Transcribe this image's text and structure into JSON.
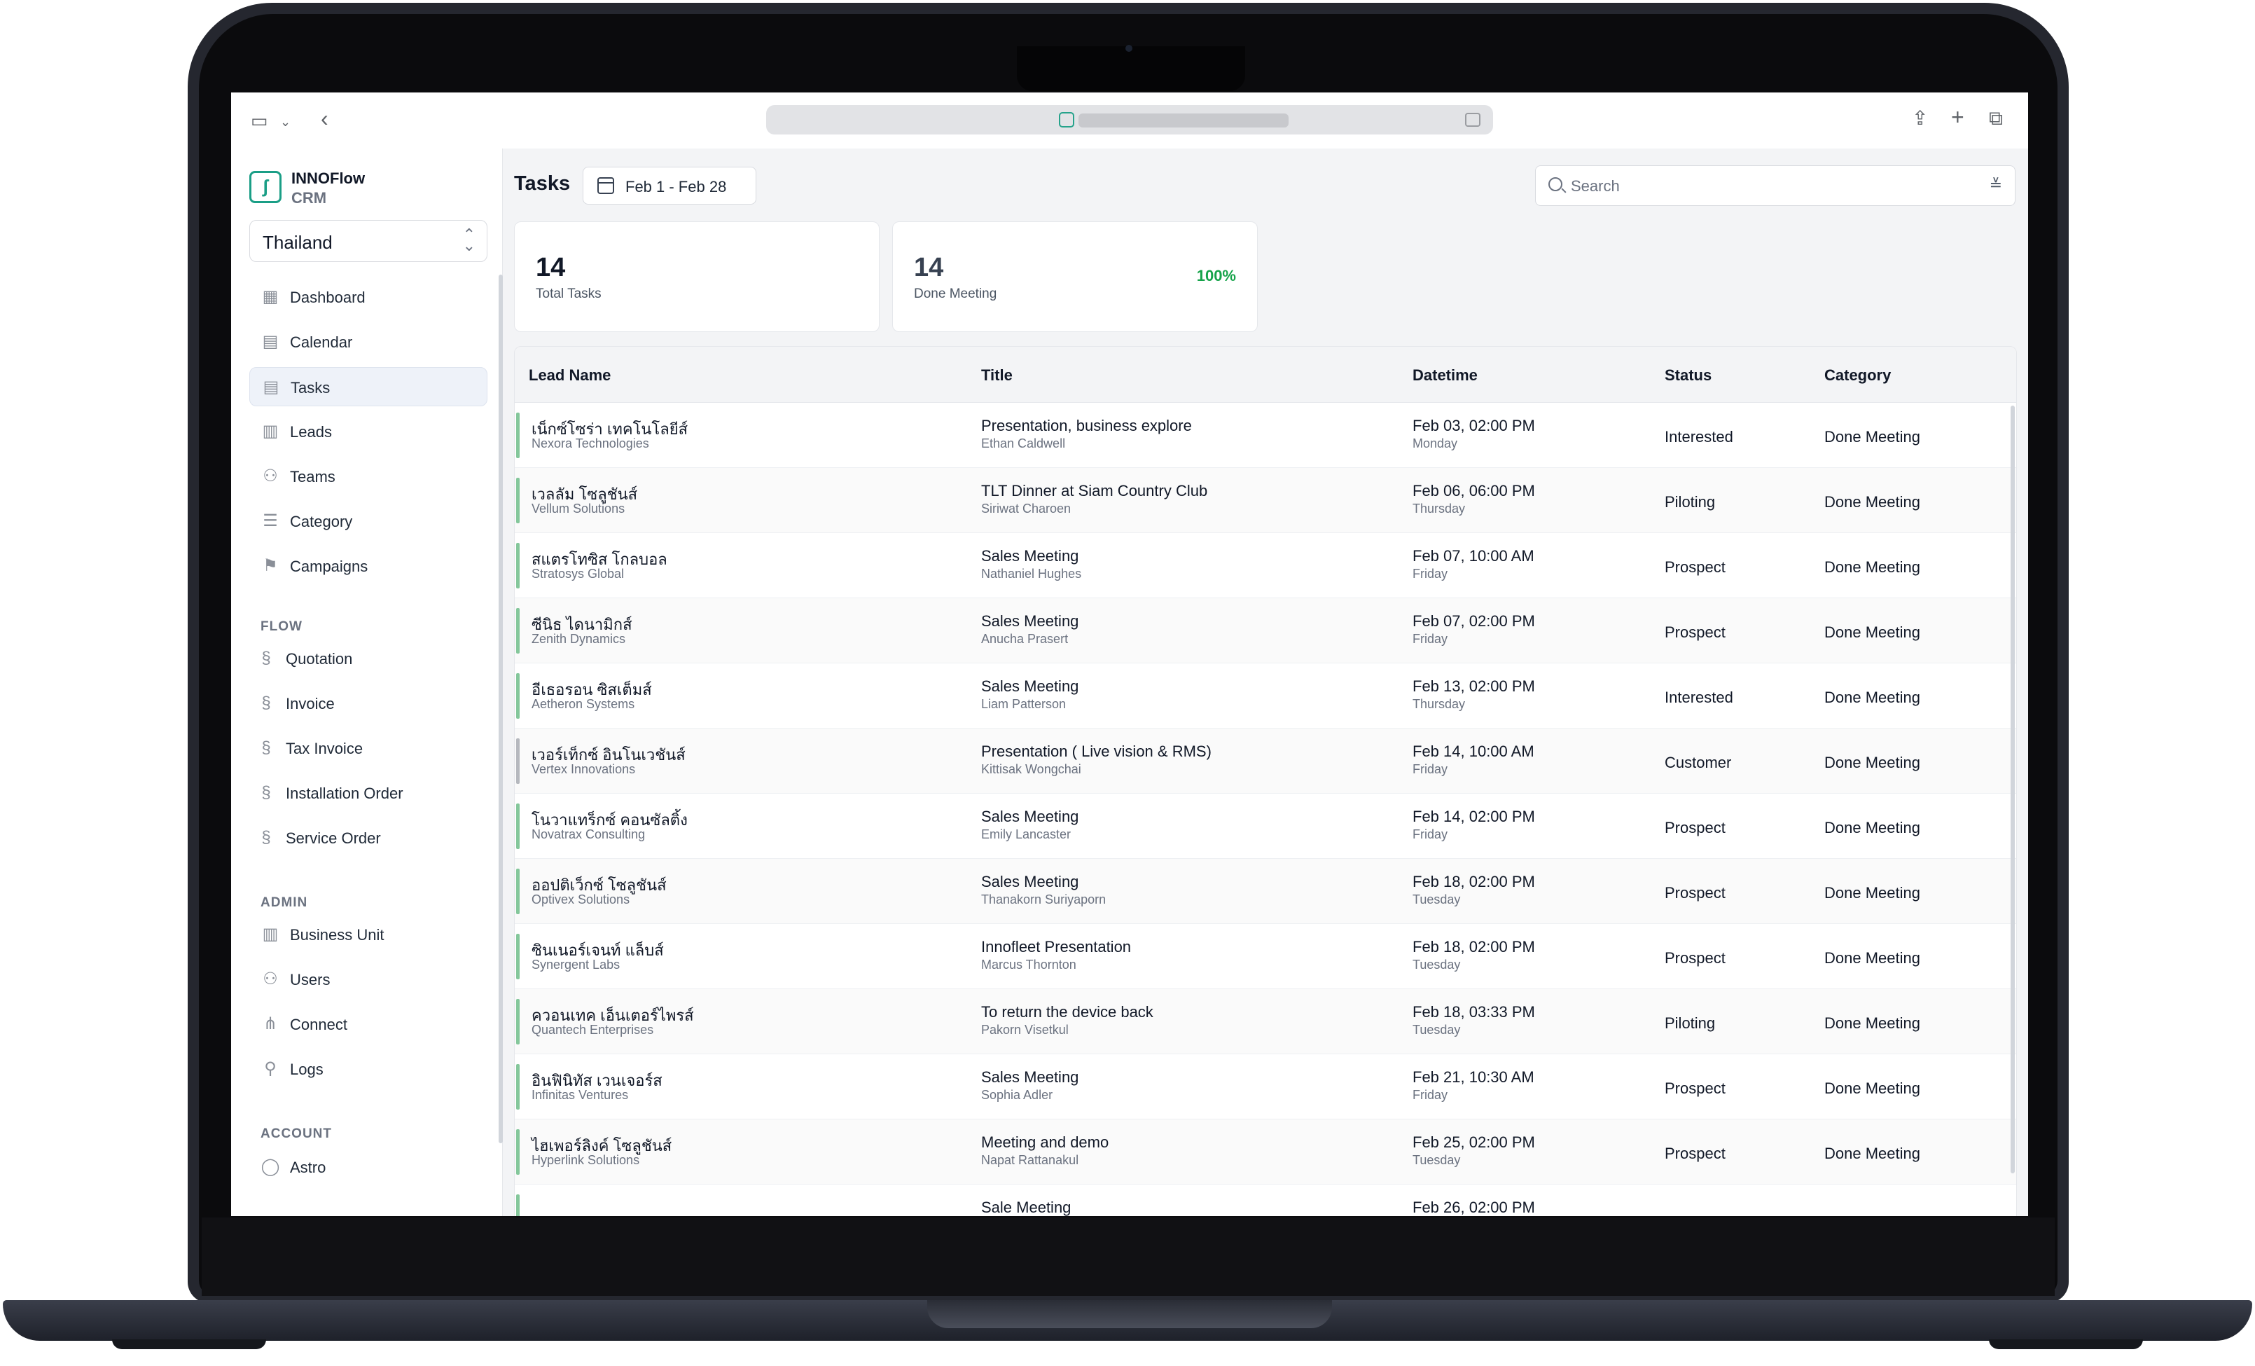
{
  "app": {
    "brand": "INNOFlow",
    "brand_sub": "CRM",
    "country": "Thailand",
    "accent": "#1a9e86"
  },
  "sidebar": {
    "main": [
      {
        "label": "Dashboard",
        "icon": "dashboard-icon"
      },
      {
        "label": "Calendar",
        "icon": "calendar-icon"
      },
      {
        "label": "Tasks",
        "icon": "tasks-icon",
        "active": true
      },
      {
        "label": "Leads",
        "icon": "leads-icon"
      },
      {
        "label": "Teams",
        "icon": "teams-icon"
      },
      {
        "label": "Category",
        "icon": "category-icon"
      },
      {
        "label": "Campaigns",
        "icon": "flag-icon"
      }
    ],
    "flow_title": "FLOW",
    "flow": [
      {
        "label": "Quotation",
        "icon": "flow-icon"
      },
      {
        "label": "Invoice",
        "icon": "flow-icon"
      },
      {
        "label": "Tax Invoice",
        "icon": "flow-icon"
      },
      {
        "label": "Installation Order",
        "icon": "flow-icon"
      },
      {
        "label": "Service Order",
        "icon": "flow-icon"
      }
    ],
    "admin_title": "ADMIN",
    "admin": [
      {
        "label": "Business Unit",
        "icon": "building-icon"
      },
      {
        "label": "Users",
        "icon": "users-icon"
      },
      {
        "label": "Connect",
        "icon": "connect-icon"
      },
      {
        "label": "Logs",
        "icon": "logs-icon"
      }
    ],
    "account_title": "ACCOUNT",
    "account": [
      {
        "label": "Astro",
        "icon": "user-circle-icon"
      }
    ]
  },
  "header": {
    "title": "Tasks",
    "date_range": "Feb 1 - Feb 28",
    "search_placeholder": "Search"
  },
  "stats": {
    "total_tasks": "14",
    "total_tasks_label": "Total Tasks",
    "done_meeting": "14",
    "done_meeting_label": "Done Meeting",
    "done_pct": "100%"
  },
  "table": {
    "columns": [
      "Lead Name",
      "Title",
      "Datetime",
      "Status",
      "Category"
    ],
    "rows": [
      {
        "lead": "เน็กซ์โซร่า เทคโนโลยีส์",
        "company": "Nexora Technologies",
        "title": "Presentation, business explore",
        "person": "Ethan Caldwell",
        "datetime": "Feb 03, 02:00 PM",
        "day": "Monday",
        "status": "Interested",
        "category": "Done Meeting"
      },
      {
        "lead": "เวลลัม โซลูชันส์",
        "company": "Vellum Solutions",
        "title": "TLT Dinner at Siam Country Club",
        "person": "Siriwat Charoen",
        "datetime": "Feb 06, 06:00 PM",
        "day": "Thursday",
        "status": "Piloting",
        "category": "Done Meeting"
      },
      {
        "lead": "สแตรโทซิส โกลบอล",
        "company": "Stratosys Global",
        "title": "Sales Meeting",
        "person": "Nathaniel Hughes",
        "datetime": "Feb 07, 10:00 AM",
        "day": "Friday",
        "status": "Prospect",
        "category": "Done Meeting"
      },
      {
        "lead": "ซีนิธ ไดนามิกส์",
        "company": "Zenith Dynamics",
        "title": "Sales Meeting",
        "person": "Anucha Prasert",
        "datetime": "Feb 07, 02:00 PM",
        "day": "Friday",
        "status": "Prospect",
        "category": "Done Meeting"
      },
      {
        "lead": "อีเธอรอน ซิสเต็มส์",
        "company": "Aetheron Systems",
        "title": "Sales Meeting",
        "person": "Liam Patterson",
        "datetime": "Feb 13, 02:00 PM",
        "day": "Thursday",
        "status": "Interested",
        "category": "Done Meeting"
      },
      {
        "lead": "เวอร์เท็กซ์ อินโนเวชันส์",
        "company": "Vertex Innovations",
        "title": "Presentation ( Live vision & RMS)",
        "person": "Kittisak Wongchai",
        "datetime": "Feb 14, 10:00 AM",
        "day": "Friday",
        "status": "Customer",
        "category": "Done Meeting"
      },
      {
        "lead": "โนวาแทร็กซ์ คอนซัลติ้ง",
        "company": "Novatrax Consulting",
        "title": "Sales Meeting",
        "person": "Emily Lancaster",
        "datetime": "Feb 14, 02:00 PM",
        "day": "Friday",
        "status": "Prospect",
        "category": "Done Meeting"
      },
      {
        "lead": "ออปติเว็กซ์ โซลูชันส์",
        "company": "Optivex Solutions",
        "title": "Sales Meeting",
        "person": "Thanakorn Suriyaporn",
        "datetime": "Feb 18, 02:00 PM",
        "day": "Tuesday",
        "status": "Prospect",
        "category": "Done Meeting"
      },
      {
        "lead": "ซินเนอร์เจนท์ แล็บส์",
        "company": "Synergent Labs",
        "title": "Innofleet Presentation",
        "person": "Marcus Thornton",
        "datetime": "Feb 18, 02:00 PM",
        "day": "Tuesday",
        "status": "Prospect",
        "category": "Done Meeting"
      },
      {
        "lead": "ควอนเทค เอ็นเตอร์ไพรส์",
        "company": "Quantech Enterprises",
        "title": "To return the device back",
        "person": "Pakorn Visetkul",
        "datetime": "Feb 18, 03:33 PM",
        "day": "Tuesday",
        "status": "Piloting",
        "category": "Done Meeting"
      },
      {
        "lead": "อินฟินิทัส เวนเจอร์ส",
        "company": "Infinitas Ventures",
        "title": "Sales Meeting",
        "person": "Sophia Adler",
        "datetime": "Feb 21, 10:30 AM",
        "day": "Friday",
        "status": "Prospect",
        "category": "Done Meeting"
      },
      {
        "lead": "ไฮเพอร์ลิงค์ โซลูชันส์",
        "company": "Hyperlink Solutions",
        "title": "Meeting and demo",
        "person": "Napat Rattanakul",
        "datetime": "Feb 25, 02:00 PM",
        "day": "Tuesday",
        "status": "Prospect",
        "category": "Done Meeting"
      },
      {
        "lead": "",
        "company": "",
        "title": "Sale Meeting",
        "person": "",
        "datetime": "Feb 26, 02:00 PM",
        "day": "",
        "status": "",
        "category": ""
      }
    ]
  }
}
